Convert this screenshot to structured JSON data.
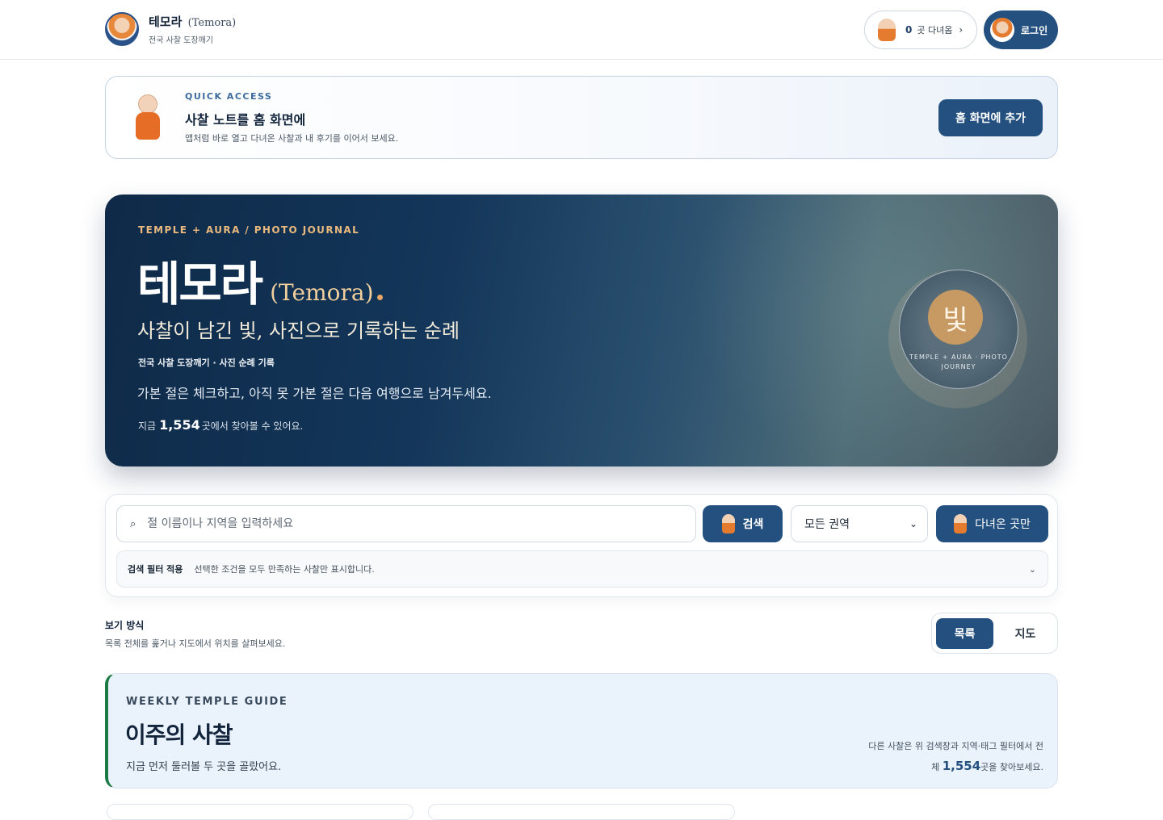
{
  "header": {
    "brand_title": "테모라",
    "brand_title_en": "(Temora)",
    "brand_subtitle": "전국 사찰 도장깨기",
    "visited_count": "0",
    "visited_label": "곳 다녀옴",
    "visited_arrow": "›",
    "login_label": "로그인"
  },
  "quick_access": {
    "eyebrow": "QUICK ACCESS",
    "title": "사찰 노트를 홈 화면에",
    "description": "앱처럼 바로 열고 다녀온 사찰과 내 후기를 이어서 보세요.",
    "button_label": "홈 화면에 추가"
  },
  "hero": {
    "eyebrow": "TEMPLE + AURA / PHOTO JOURNAL",
    "title": "테모라",
    "title_en": "(Temora)",
    "subtitle": "사찰이 남긴 빛, 사진으로 기록하는 순례",
    "tags": "전국 사찰 도장깨기 · 사진 순례 기록",
    "description": "가본 절은 체크하고, 아직 못 가본 절은 다음 여행으로 남겨두세요.",
    "count_prefix": "지금",
    "count_value": "1,554",
    "count_suffix": "곳에서 찾아볼 수 있어요.",
    "badge_glyph": "빛",
    "badge_text": "TEMPLE + AURA · PHOTO JOURNEY"
  },
  "search": {
    "placeholder": "절 이름이나 지역을 입력하세요",
    "search_button": "검색",
    "region_selected": "모든 권역",
    "visited_button": "다녀온 곳만",
    "filter_title": "검색 필터 적용",
    "filter_desc": "선택한 조건을 모두 만족하는 사찰만 표시합니다."
  },
  "view_mode": {
    "title": "보기 방식",
    "description": "목록 전체를 훑거나 지도에서 위치를 살펴보세요.",
    "list_label": "목록",
    "map_label": "지도"
  },
  "weekly": {
    "eyebrow": "WEEKLY TEMPLE GUIDE",
    "title": "이주의 사찰",
    "description": "지금 먼저 둘러볼 두 곳을 골랐어요.",
    "note_prefix": "다른 사찰은 위 검색창과 지역·태그 필터에서 전체",
    "note_value": "1,554",
    "note_suffix": "곳을 찾아보세요."
  },
  "colors": {
    "primary": "#24507f",
    "hero_accent": "#e9b97e",
    "weekly_bar": "#1c7a45"
  }
}
